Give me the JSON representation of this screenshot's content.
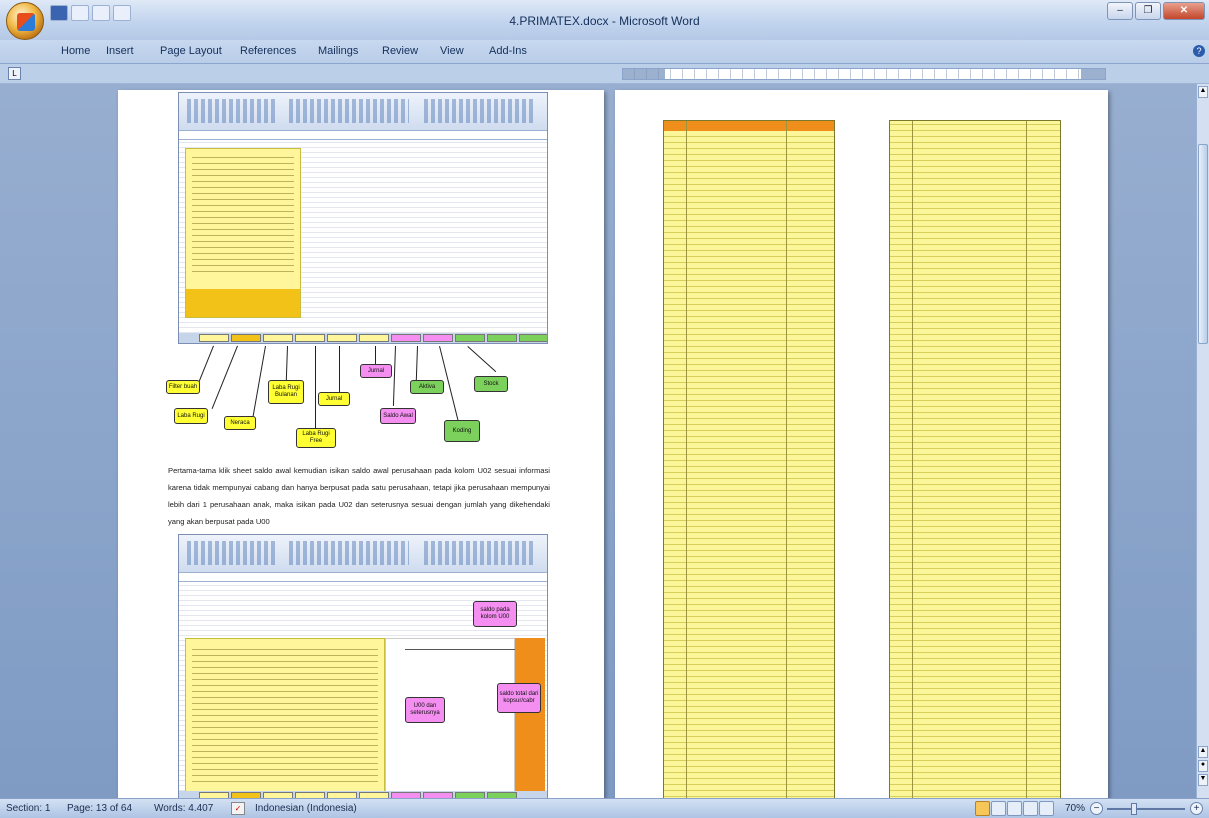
{
  "window": {
    "title": "4.PRIMATEX.docx - Microsoft Word",
    "controls": [
      "minimize",
      "restore",
      "close"
    ]
  },
  "ribbon": {
    "tabs": [
      "Home",
      "Insert",
      "Page Layout",
      "References",
      "Mailings",
      "Review",
      "View",
      "Add-Ins"
    ]
  },
  "left_page": {
    "callouts": [
      {
        "text": "Filter buah",
        "color": "yellow"
      },
      {
        "text": "Laba Rugi",
        "color": "yellow"
      },
      {
        "text": "Neraca",
        "color": "yellow"
      },
      {
        "text": "Laba Rugi Bulanan",
        "color": "yellow"
      },
      {
        "text": "Laba Rugi Free",
        "color": "yellow"
      },
      {
        "text": "Jurnal",
        "color": "yellow"
      },
      {
        "text": "Jurnal",
        "color": "pink"
      },
      {
        "text": "Saldo Awal",
        "color": "pink"
      },
      {
        "text": "Aktiva",
        "color": "green"
      },
      {
        "text": "Koding",
        "color": "green"
      },
      {
        "text": "Stock",
        "color": "green"
      }
    ],
    "paragraph": "Pertama-tama klik sheet saldo awal kemudian isikan saldo awal perusahaan pada kolom U02 sesuai informasi karena tidak mempunyai cabang dan hanya berpusat pada satu perusahaan, tetapi jika perusahaan mempunyai lebih dari 1 perusahaan anak, maka isikan pada U02 dan seterusnya sesuai dengan jumlah yang dikehendaki yang akan berpusat pada U00",
    "callouts2": [
      {
        "text": "saldo pada kolom U00",
        "color": "pink"
      },
      {
        "text": "U00 dan seterusnya",
        "color": "pink"
      },
      {
        "text": "saldo total dari kopsur/cabr",
        "color": "pink"
      }
    ]
  },
  "status_bar": {
    "section": "Section: 1",
    "page": "Page: 13 of 64",
    "words": "Words: 4.407",
    "language": "Indonesian (Indonesia)",
    "zoom": "70%"
  },
  "colors": {
    "accent": "#2a5cab",
    "sheet_yellow": "#fff59a",
    "header_orange": "#ef8e1b"
  }
}
